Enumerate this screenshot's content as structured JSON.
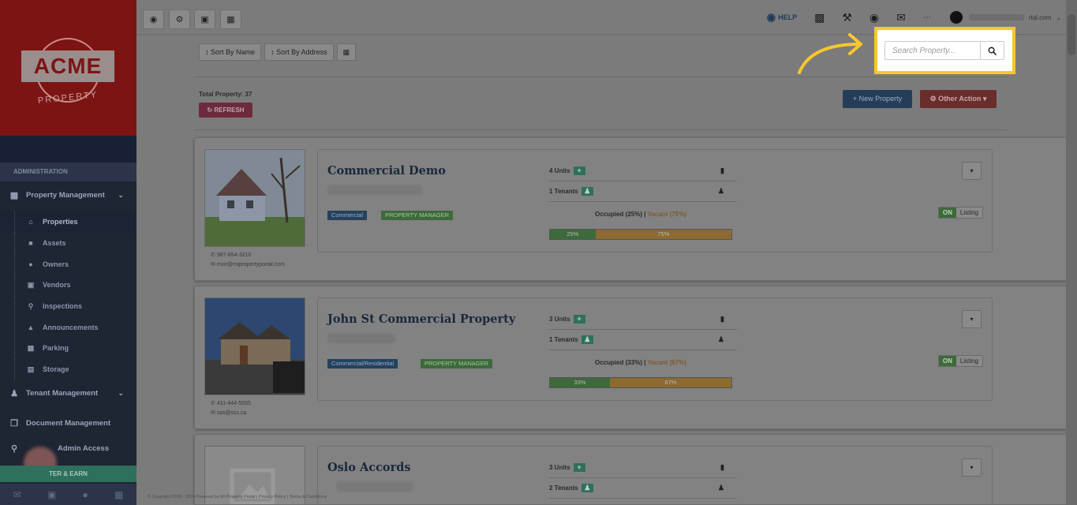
{
  "brand": {
    "logo": "ACME",
    "logo_sub": "PROPERTY"
  },
  "sidebar": {
    "section_label": "ADMINISTRATION",
    "groups": [
      {
        "label": "Property Management",
        "icon": "building-icon"
      }
    ],
    "sub_items": [
      {
        "label": "Properties",
        "icon": "home-icon"
      },
      {
        "label": "Assets",
        "icon": "archive-icon"
      },
      {
        "label": "Owners",
        "icon": "user-icon"
      },
      {
        "label": "Vendors",
        "icon": "briefcase-icon"
      },
      {
        "label": "Inspections",
        "icon": "search-icon"
      },
      {
        "label": "Announcements",
        "icon": "bullhorn-icon"
      },
      {
        "label": "Parking",
        "icon": "car-icon"
      },
      {
        "label": "Storage",
        "icon": "box-icon"
      }
    ],
    "tenant_management": "Tenant Management",
    "document_management": "Document Management",
    "admin_access": "Admin Access",
    "refer": "TER & EARN"
  },
  "topbar": {
    "help": "HELP",
    "user_email_suffix": "rtal.com"
  },
  "toolbar": {
    "sort_name": "Sort By Name",
    "sort_address": "Sort By Address"
  },
  "summary": {
    "total": "Total Property: 37",
    "refresh": "REFRESH",
    "new_property": "New Property",
    "other_action": "Other Action"
  },
  "search": {
    "placeholder": "Search Property..."
  },
  "properties": [
    {
      "name": "Commercial Demo",
      "tags": [
        "Commercial",
        "PROPERTY MANAGER"
      ],
      "units": "4 Units",
      "tenants": "1 Tenants",
      "occupied_text": "Occupied (25%)",
      "vacant_text": "Vacant (75%)",
      "occupied_pct": 25,
      "occupied_label": "25%",
      "vacant_label": "75%",
      "phone": "987-654-3210",
      "email": "mvir@mipropertyportal.com",
      "listing_on": "ON",
      "listing": "Listing"
    },
    {
      "name": "John St Commercial Property",
      "tags": [
        "Commercial/Residential",
        "PROPERTY MANAGER"
      ],
      "units": "3 Units",
      "tenants": "1 Tenants",
      "occupied_text": "Occupied (33%)",
      "vacant_text": "Vacant (67%)",
      "occupied_pct": 33,
      "occupied_label": "33%",
      "vacant_label": "67%",
      "phone": "411-444-5555",
      "email": "sss@sss.ca",
      "listing_on": "ON",
      "listing": "Listing"
    },
    {
      "name": "Oslo Accords",
      "units": "3 Units",
      "tenants": "2 Tenants"
    }
  ],
  "footer": "© Copyright 2018 - 2024 Powered by MI Property Portal | Privacy Policy | Terms & Conditions"
}
